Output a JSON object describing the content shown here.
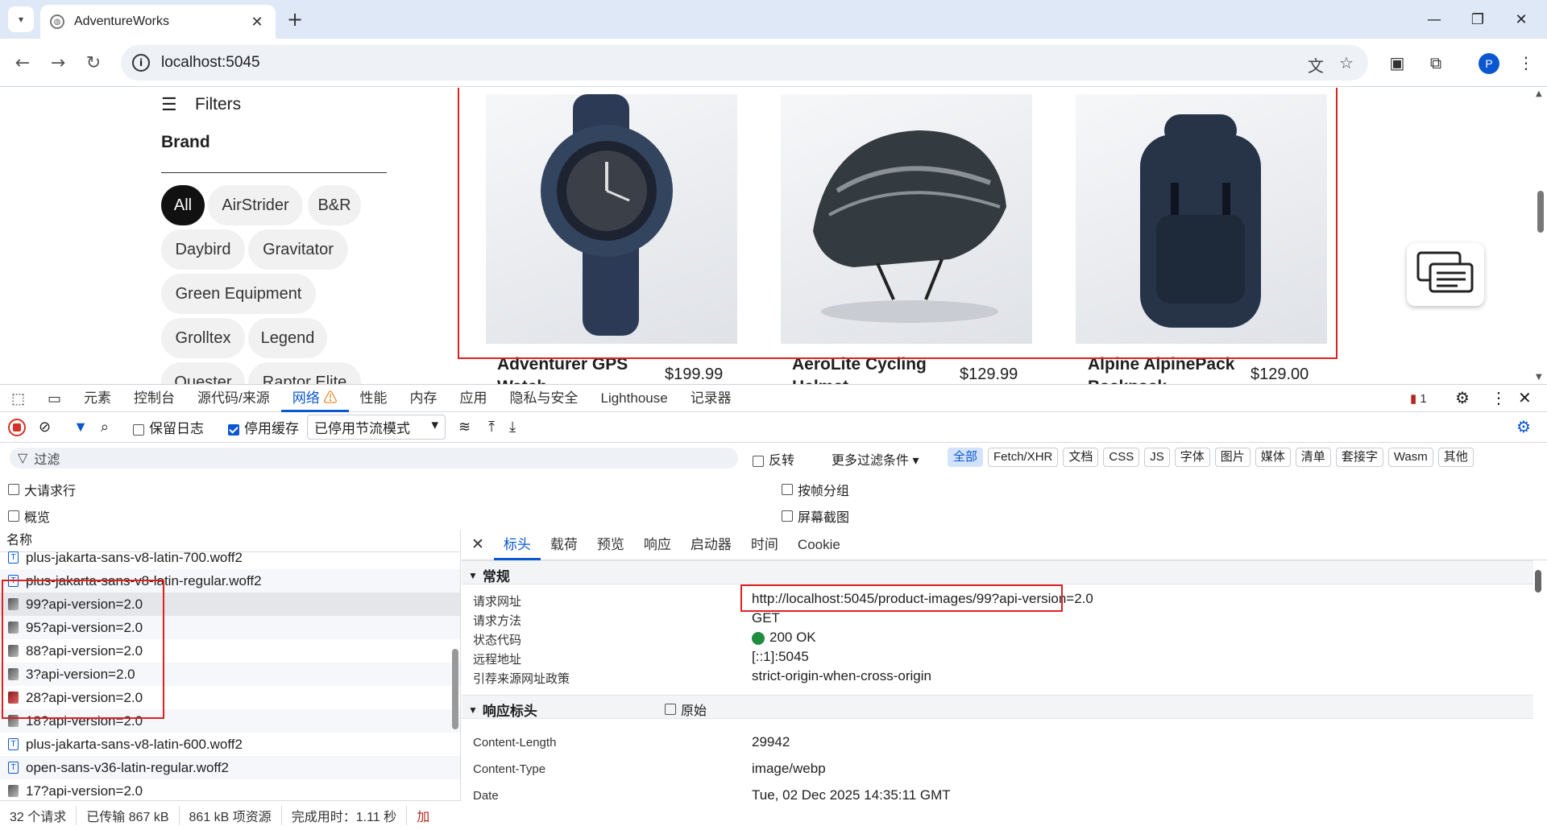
{
  "browser": {
    "tab_title": "AdventureWorks",
    "url": "localhost:5045",
    "profile_initial": "P"
  },
  "page": {
    "filters_label": "Filters",
    "brand_label": "Brand",
    "brand_chips": [
      "All",
      "AirStrider",
      "B&R",
      "Daybird",
      "Gravitator",
      "Green Equipment",
      "Grolltex",
      "Legend",
      "Quester",
      "Raptor Elite"
    ],
    "products": [
      {
        "name": "Adventurer GPS Watch",
        "price": "$199.99",
        "image": "watch-image"
      },
      {
        "name": "AeroLite Cycling Helmet",
        "price": "$129.99",
        "image": "helmet-image"
      },
      {
        "name": "Alpine AlpinePack Backpack",
        "price": "$129.00",
        "image": "backpack-image"
      }
    ]
  },
  "devtools": {
    "tabs": [
      "元素",
      "控制台",
      "源代码/来源",
      "网络",
      "性能",
      "内存",
      "应用",
      "隐私与安全",
      "Lighthouse",
      "记录器"
    ],
    "active_tab": "网络",
    "issues_count": "1",
    "preserve_log": "保留日志",
    "disable_cache": "停用缓存",
    "throttle": "已停用节流模式",
    "filter_placeholder": "过滤",
    "invert": "反转",
    "more_filters": "更多过滤条件",
    "filter_types": [
      "全部",
      "Fetch/XHR",
      "文档",
      "CSS",
      "JS",
      "字体",
      "图片",
      "媒体",
      "清单",
      "套接字",
      "Wasm",
      "其他"
    ],
    "big_rows": "大请求行",
    "overview": "概览",
    "group_by_frame": "按帧分组",
    "screenshots": "屏幕截图",
    "name_col": "名称",
    "requests": [
      {
        "name": "plus-jakarta-sans-v8-latin-700.woff2",
        "type": "font"
      },
      {
        "name": "plus-jakarta-sans-v8-latin-regular.woff2",
        "type": "font"
      },
      {
        "name": "99?api-version=2.0",
        "type": "img"
      },
      {
        "name": "95?api-version=2.0",
        "type": "img"
      },
      {
        "name": "88?api-version=2.0",
        "type": "img"
      },
      {
        "name": "3?api-version=2.0",
        "type": "img"
      },
      {
        "name": "28?api-version=2.0",
        "type": "img"
      },
      {
        "name": "18?api-version=2.0",
        "type": "img"
      },
      {
        "name": "plus-jakarta-sans-v8-latin-600.woff2",
        "type": "font"
      },
      {
        "name": "open-sans-v36-latin-regular.woff2",
        "type": "font"
      },
      {
        "name": "17?api-version=2.0",
        "type": "img"
      }
    ],
    "status": {
      "requests": "32 个请求",
      "transferred": "已传输 867 kB",
      "resources": "861 kB 项资源",
      "finish": "完成用时：1.11 秒",
      "extra": "加"
    },
    "detail_tabs": [
      "标头",
      "载荷",
      "预览",
      "响应",
      "启动器",
      "时间",
      "Cookie"
    ],
    "general_label": "常规",
    "general": [
      {
        "k": "请求网址",
        "v": "http://localhost:5045/product-images/99?api-version=2.0"
      },
      {
        "k": "请求方法",
        "v": "GET"
      },
      {
        "k": "状态代码",
        "v": "200 OK"
      },
      {
        "k": "远程地址",
        "v": "[::1]:5045"
      },
      {
        "k": "引荐来源网址政策",
        "v": "strict-origin-when-cross-origin"
      }
    ],
    "response_headers_label": "响应标头",
    "raw_label": "原始",
    "response_headers": [
      {
        "k": "Content-Length",
        "v": "29942"
      },
      {
        "k": "Content-Type",
        "v": "image/webp"
      },
      {
        "k": "Date",
        "v": "Tue, 02 Dec 2025 14:35:11 GMT"
      }
    ]
  },
  "colors": {
    "accent": "#0b57d0",
    "highlight": "#e02020",
    "ok": "#1e8e3e"
  }
}
